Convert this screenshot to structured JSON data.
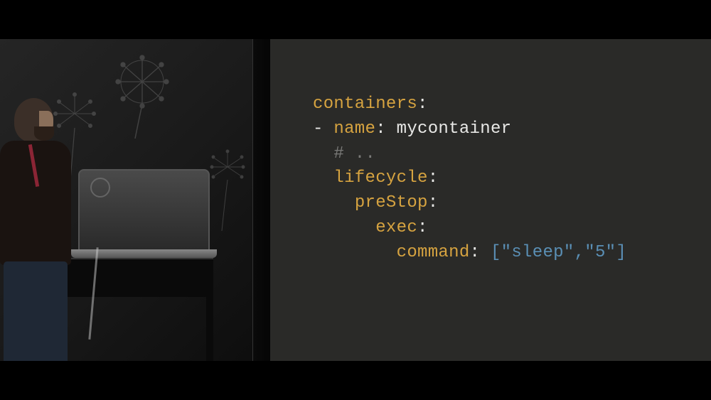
{
  "slide": {
    "code": {
      "line1_key": "containers",
      "line1_colon": ":",
      "line2_dash": "- ",
      "line2_key": "name",
      "line2_colon": ": ",
      "line2_val": "mycontainer",
      "line3_comment": "# ..",
      "line4_key": "lifecycle",
      "line4_colon": ":",
      "line5_key": "preStop",
      "line5_colon": ":",
      "line6_key": "exec",
      "line6_colon": ":",
      "line7_key": "command",
      "line7_colon": ": ",
      "line7_val": "[\"sleep\",\"5\"]"
    }
  },
  "colors": {
    "slide_bg": "#2a2a28",
    "keyword": "#d6a340",
    "string": "#e8e8e6",
    "comment": "#7a7a78",
    "bracket": "#5a8fb5"
  }
}
